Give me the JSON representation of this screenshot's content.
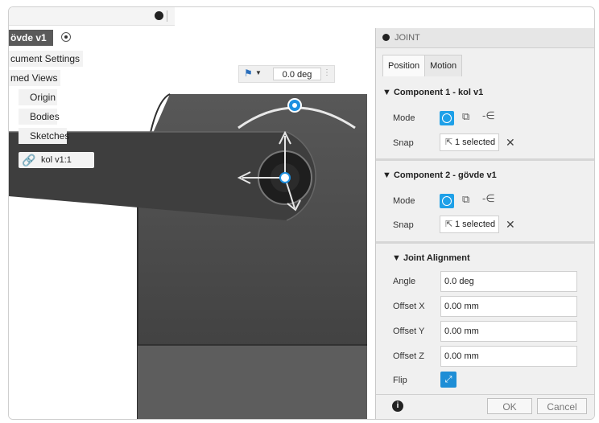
{
  "browser": {
    "root_label": "övde v1",
    "items": [
      "cument Settings",
      "med Views",
      "Origin",
      "Bodies",
      "Sketches",
      "kol v1:1"
    ]
  },
  "viewport": {
    "angle_value": "0.0 deg"
  },
  "panel": {
    "title": "JOINT",
    "tabs": [
      "Position",
      "Motion"
    ],
    "comp1": {
      "header": "Component 1 - kol v1",
      "mode_label": "Mode",
      "snap_label": "Snap",
      "snap_value": "1 selected"
    },
    "comp2": {
      "header": "Component 2 - gövde v1",
      "mode_label": "Mode",
      "snap_label": "Snap",
      "snap_value": "1 selected"
    },
    "alignment": {
      "header": "Joint Alignment",
      "angle_label": "Angle",
      "angle_value": "0.0 deg",
      "offset_x_label": "Offset X",
      "offset_x_value": "0.00 mm",
      "offset_y_label": "Offset Y",
      "offset_y_value": "0.00 mm",
      "offset_z_label": "Offset Z",
      "offset_z_value": "0.00 mm",
      "flip_label": "Flip"
    },
    "ok_label": "OK",
    "cancel_label": "Cancel"
  },
  "colors": {
    "accent": "#1ea0e8",
    "body_dark": "#4a4a4a"
  },
  "icons": {
    "panel_collapse": "filled-circle-icon",
    "close_snap": "x-icon",
    "info": "info-icon",
    "flip": "flip-icon"
  }
}
